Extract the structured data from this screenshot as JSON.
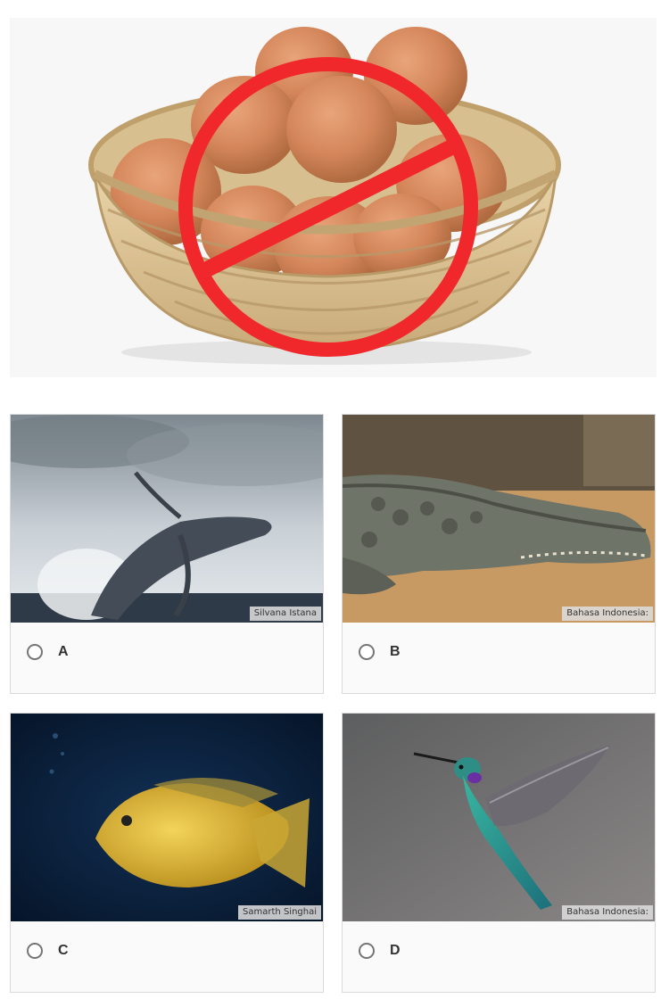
{
  "question": {
    "image_icon": "no-eggs-icon"
  },
  "options": [
    {
      "label": "A",
      "credit": "Silvana Istana",
      "image_icon": "whale-icon"
    },
    {
      "label": "B",
      "credit": "Bahasa Indonesia:",
      "image_icon": "crocodile-icon"
    },
    {
      "label": "C",
      "credit": "Samarth Singhai",
      "image_icon": "fish-icon"
    },
    {
      "label": "D",
      "credit": "Bahasa Indonesia:",
      "image_icon": "hummingbird-icon"
    }
  ],
  "colors": {
    "prohibition_red": "#f0272b",
    "radio_border": "#757575",
    "card_border": "#d9d9d9"
  }
}
